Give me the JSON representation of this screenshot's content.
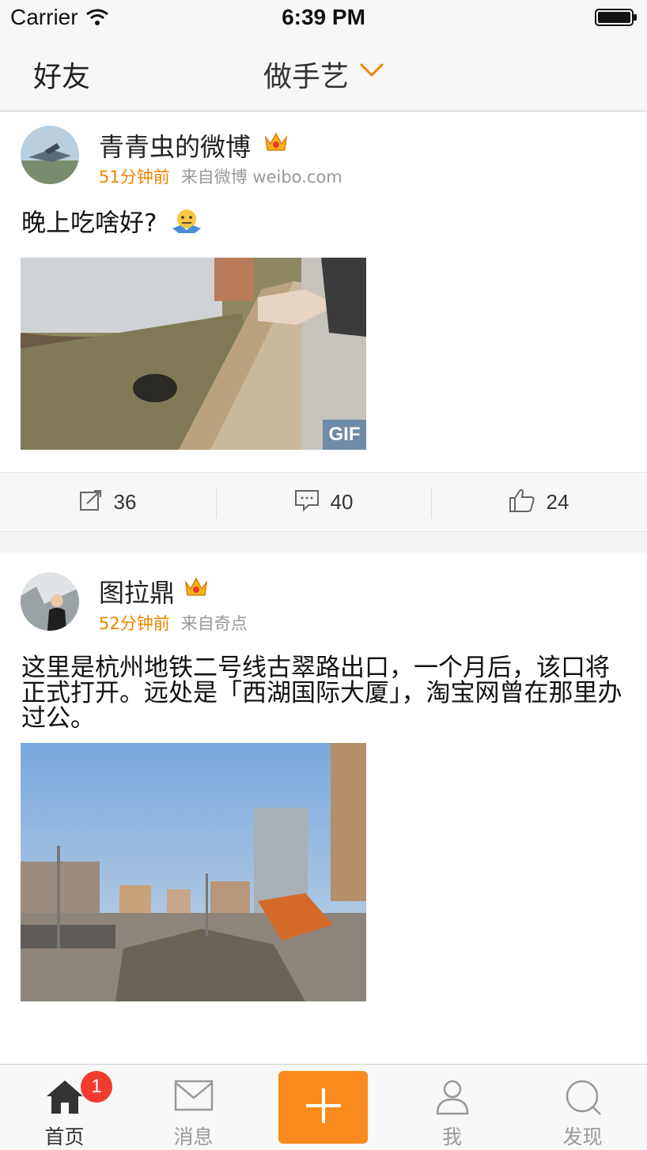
{
  "status_bar": {
    "carrier": "Carrier",
    "time": "6:39 PM"
  },
  "nav": {
    "left_label": "好友",
    "title": "做手艺"
  },
  "posts": [
    {
      "username": "青青虫的微博",
      "time_ago": "51分钟前",
      "source": "来自微博 weibo.com",
      "text": "晚上吃啥好?",
      "badge_label": "GIF",
      "repost_count": "36",
      "comment_count": "40",
      "like_count": "24"
    },
    {
      "username": "图拉鼎",
      "time_ago": "52分钟前",
      "source": "来自奇点",
      "text": "这里是杭州地铁二号线古翠路出口，一个月后，该口将正式打开。远处是「西湖国际大厦」，淘宝网曾在那里办过公。"
    }
  ],
  "tabs": [
    {
      "label": "首页",
      "icon": "home-icon",
      "badge": "1"
    },
    {
      "label": "消息",
      "icon": "envelope-icon"
    },
    {
      "label": "",
      "icon": "plus-icon"
    },
    {
      "label": "我",
      "icon": "person-icon"
    },
    {
      "label": "发现",
      "icon": "search-icon"
    }
  ],
  "colors": {
    "accent": "#f08300",
    "compose": "#f98b1e",
    "badge": "#f23b2f"
  }
}
